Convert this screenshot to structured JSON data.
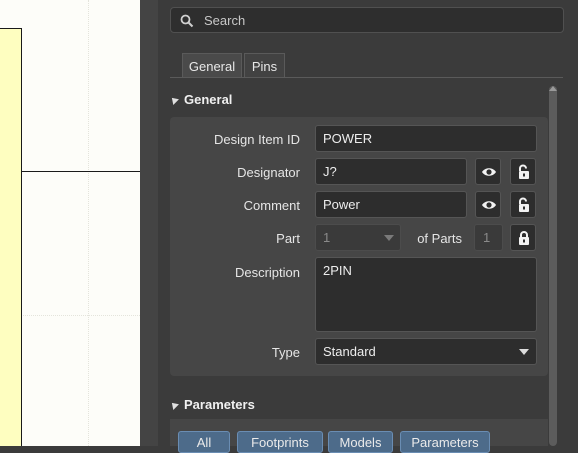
{
  "search": {
    "placeholder": "Search"
  },
  "tabs": [
    {
      "label": "General"
    },
    {
      "label": "Pins"
    }
  ],
  "sections": {
    "general": "General",
    "parameters": "Parameters"
  },
  "properties": {
    "design_item_id": {
      "label": "Design Item ID",
      "value": "POWER"
    },
    "designator": {
      "label": "Designator",
      "value": "J?"
    },
    "comment": {
      "label": "Comment",
      "value": "Power"
    },
    "part": {
      "label": "Part",
      "value": "1",
      "of_parts_label": "of Parts",
      "of_parts_value": "1"
    },
    "description": {
      "label": "Description",
      "value": "2PIN"
    },
    "type": {
      "label": "Type",
      "value": "Standard"
    }
  },
  "parameter_filters": [
    {
      "label": "All"
    },
    {
      "label": "Footprints"
    },
    {
      "label": "Models"
    },
    {
      "label": "Parameters"
    }
  ],
  "icons": [
    "search-icon",
    "eye-icon",
    "unlock-icon",
    "lock-icon",
    "chevron-down-icon",
    "collapse-triangle-icon"
  ],
  "colors": {
    "panel_bg": "#3b3b3b",
    "field_bg": "#2d2d2d",
    "sheet_yellow": "#fefec0",
    "filter_button": "#4d6b8a"
  }
}
